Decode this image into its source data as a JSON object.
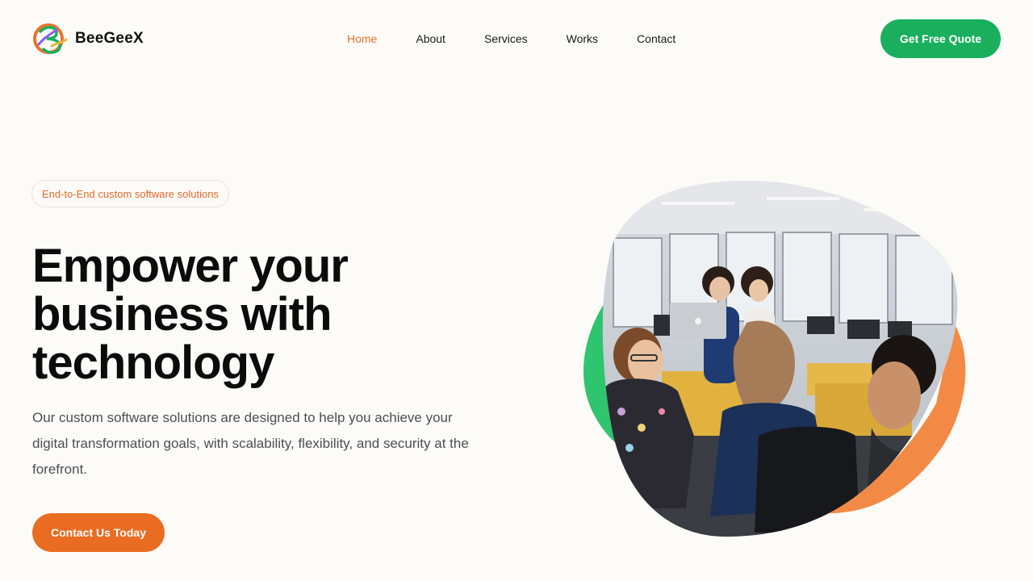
{
  "brand": {
    "name": "BeeGeeX",
    "logo_icon": "beegeex-logo-icon",
    "colors": {
      "orange": "#e8732c",
      "green": "#1aaf5d",
      "purple": "#8b5cf6"
    }
  },
  "nav": {
    "items": [
      {
        "label": "Home",
        "active": true
      },
      {
        "label": "About",
        "active": false
      },
      {
        "label": "Services",
        "active": false
      },
      {
        "label": "Works",
        "active": false
      },
      {
        "label": "Contact",
        "active": false
      }
    ]
  },
  "header": {
    "cta_label": "Get Free Quote"
  },
  "hero": {
    "badge": "End-to-End custom software solutions",
    "headline_lines": [
      "Empower your",
      "business with",
      "technology"
    ],
    "description": "Our custom software solutions are designed to help you achieve your digital transformation goals, with scalability, flexibility, and security at the forefront.",
    "cta_label": "Contact Us Today",
    "image_subject": "team-collaborating-in-office-photo",
    "accent_shapes": {
      "left_blob": "#2fc46e",
      "right_blob": "#f28a45"
    }
  }
}
